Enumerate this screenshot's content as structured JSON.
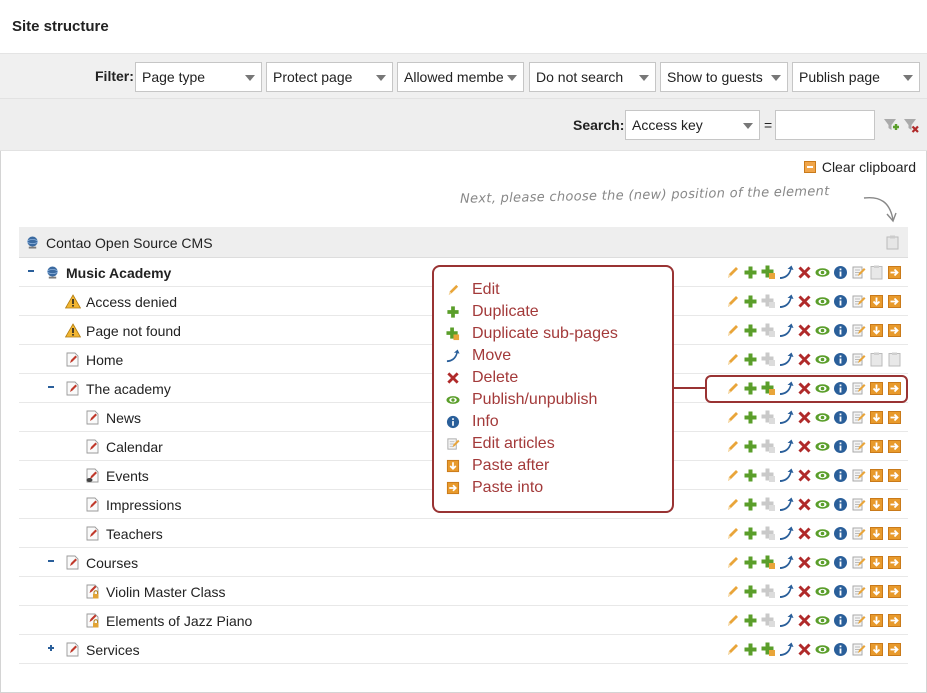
{
  "header": {
    "title": "Site structure"
  },
  "filter": {
    "label": "Filter:",
    "selects": [
      {
        "value": "Page type"
      },
      {
        "value": "Protect page"
      },
      {
        "value": "Allowed membe"
      },
      {
        "value": "Do not search"
      },
      {
        "value": "Show to guests"
      },
      {
        "value": "Publish page"
      }
    ]
  },
  "search": {
    "label": "Search:",
    "field_value": "Access key",
    "operator": "=",
    "query": ""
  },
  "clipboard": {
    "label": "Clear clipboard"
  },
  "hint": "Next, please choose the (new) position of the element",
  "tree": {
    "root": {
      "label": "Contao Open Source CMS"
    },
    "rows": [
      {
        "label": "Music Academy",
        "bold": true,
        "level": 0,
        "toggle": "minus",
        "icon": "globe-icon"
      },
      {
        "label": "Access denied",
        "level": 1,
        "toggle": "",
        "icon": "warning-icon"
      },
      {
        "label": "Page not found",
        "level": 1,
        "toggle": "",
        "icon": "warning-icon"
      },
      {
        "label": "Home",
        "level": 1,
        "toggle": "",
        "icon": "page-icon"
      },
      {
        "label": "The academy",
        "level": 1,
        "toggle": "minus",
        "icon": "page-icon"
      },
      {
        "label": "News",
        "level": 2,
        "toggle": "",
        "icon": "page-icon"
      },
      {
        "label": "Calendar",
        "level": 2,
        "toggle": "",
        "icon": "page-icon"
      },
      {
        "label": "Events",
        "level": 2,
        "toggle": "",
        "icon": "page-hidden-icon"
      },
      {
        "label": "Impressions",
        "level": 2,
        "toggle": "",
        "icon": "page-icon"
      },
      {
        "label": "Teachers",
        "level": 2,
        "toggle": "",
        "icon": "page-icon"
      },
      {
        "label": "Courses",
        "level": 1,
        "toggle": "minus",
        "icon": "page-icon"
      },
      {
        "label": "Violin Master Class",
        "level": 2,
        "toggle": "",
        "icon": "page-protected-icon"
      },
      {
        "label": "Elements of Jazz Piano",
        "level": 2,
        "toggle": "",
        "icon": "page-protected-icon"
      },
      {
        "label": "Services",
        "level": 1,
        "toggle": "plus",
        "icon": "page-icon"
      }
    ]
  },
  "legend": {
    "items": [
      {
        "label": "Edit",
        "icon": "pencil-icon"
      },
      {
        "label": "Duplicate",
        "icon": "plus-icon"
      },
      {
        "label": "Duplicate sub-pages",
        "icon": "plus-multiple-icon"
      },
      {
        "label": "Move",
        "icon": "move-icon"
      },
      {
        "label": "Delete",
        "icon": "delete-icon"
      },
      {
        "label": "Publish/unpublish",
        "icon": "eye-icon"
      },
      {
        "label": "Info",
        "icon": "info-icon"
      },
      {
        "label": "Edit articles",
        "icon": "articles-icon"
      },
      {
        "label": "Paste after",
        "icon": "paste-after-icon"
      },
      {
        "label": "Paste into",
        "icon": "paste-into-icon"
      }
    ]
  },
  "colors": {
    "accent": "#993333",
    "green": "#5a9e2a",
    "orange": "#e89a2c",
    "blue": "#2a5f9a",
    "red": "#b02a2a"
  }
}
